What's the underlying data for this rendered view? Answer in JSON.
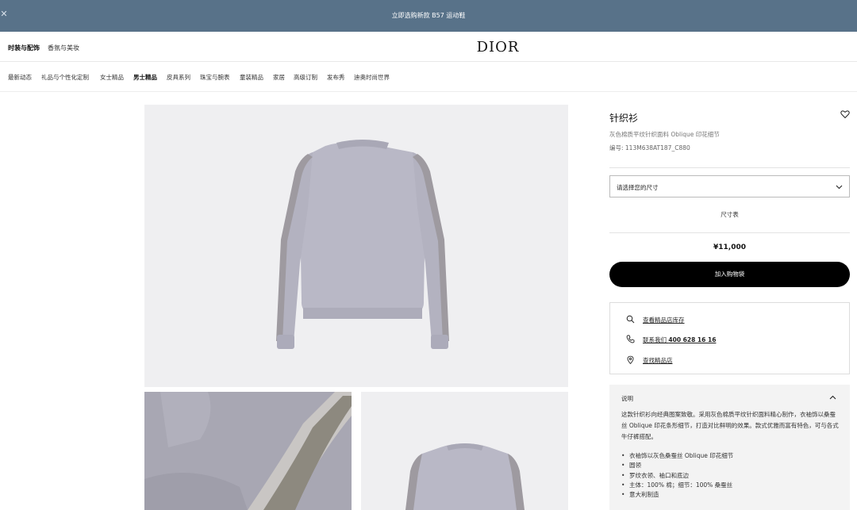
{
  "promo": {
    "close_icon": "close-icon",
    "text": "立即选购新款 B57 运动鞋"
  },
  "header": {
    "tabs": [
      "时装与配饰",
      "香氛与美妆"
    ],
    "logo": "DIOR"
  },
  "nav": {
    "items": [
      "最新动态",
      "礼品与个性化定制",
      "女士精品",
      "男士精品",
      "皮具系列",
      "珠宝与腕表",
      "童装精品",
      "家居",
      "高级订制",
      "发布秀",
      "迪奥时尚世界"
    ],
    "active": "男士精品"
  },
  "product": {
    "name": "针织衫",
    "subtitle": "灰色棉质平纹针织面料 Oblique 印花细节",
    "ref": "编号: 113M638AT187_C880",
    "size_placeholder": "请选择您的尺寸",
    "size_guide": "尺寸表",
    "price": "¥11,000",
    "add_to_bag": "加入购物袋"
  },
  "services": [
    {
      "icon": "search-icon",
      "text": "查看精品店库存"
    },
    {
      "icon": "phone-icon",
      "text": "联系我们",
      "bold": "400 628 16 16"
    },
    {
      "icon": "location-pin-icon",
      "text": "查找精品店"
    }
  ],
  "description": {
    "title": "说明",
    "body": "这款针织衫向经典图案致敬。采用灰色棉质平纹针织面料精心制作，衣袖饰以桑蚕丝 Oblique 印花条形细节，打造对比鲜明的效果。款式优雅而富有特色，可与各式牛仔裤搭配。",
    "bullets": [
      "衣袖饰以灰色桑蚕丝 Oblique 印花细节",
      "圆领",
      "罗纹衣领、袖口和底边",
      "主体：100% 棉；细节：100% 桑蚕丝",
      "意大利制造"
    ]
  },
  "colors": {
    "promo_bg": "#587289",
    "button_bg": "#000000",
    "sweater": "#b9b8c6",
    "band": "#9e9aa0"
  }
}
